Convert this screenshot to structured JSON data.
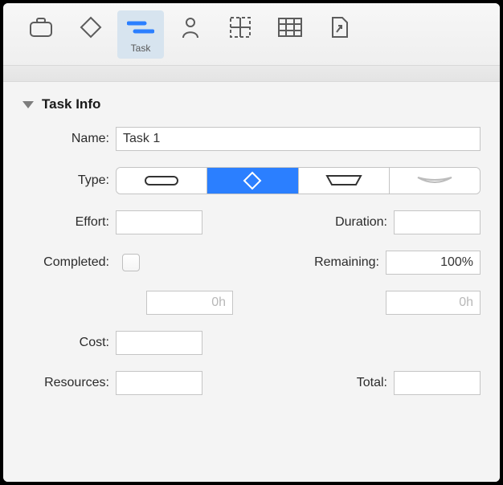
{
  "toolbar": {
    "items": [
      {
        "name": "briefcase"
      },
      {
        "name": "milestone"
      },
      {
        "name": "task",
        "label": "Task",
        "selected": true
      },
      {
        "name": "resource"
      },
      {
        "name": "dashboard"
      },
      {
        "name": "table"
      },
      {
        "name": "report"
      }
    ]
  },
  "section": {
    "title": "Task Info",
    "expanded": true
  },
  "fields": {
    "name_label": "Name:",
    "name_value": "Task 1",
    "type_label": "Type:",
    "effort_label": "Effort:",
    "effort_value": "",
    "duration_label": "Duration:",
    "duration_value": "",
    "completed_label": "Completed:",
    "completed_checked": false,
    "remaining_label": "Remaining:",
    "remaining_value": "100%",
    "completed_effort_value": "0h",
    "remaining_effort_value": "0h",
    "cost_label": "Cost:",
    "cost_value": "",
    "resources_label": "Resources:",
    "resources_value": "",
    "total_label": "Total:",
    "total_value": ""
  },
  "type_options": [
    {
      "name": "task-rounded",
      "selected": false
    },
    {
      "name": "milestone-diamond",
      "selected": true
    },
    {
      "name": "group-bracket",
      "selected": false
    },
    {
      "name": "hammock",
      "selected": false
    }
  ]
}
